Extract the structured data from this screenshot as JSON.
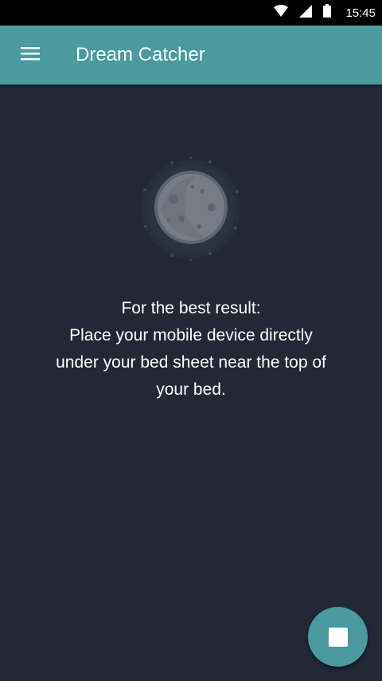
{
  "status_bar": {
    "time": "15:45",
    "icons": [
      "wifi-icon",
      "signal-icon",
      "battery-icon"
    ]
  },
  "app_bar": {
    "menu_icon": "hamburger-menu-icon",
    "title": "Dream Catcher"
  },
  "main": {
    "illustration_icon": "moon-icon",
    "instruction_lines": [
      "For the best result:",
      "Place your mobile device directly",
      "under your bed sheet near the top of",
      "your bed."
    ]
  },
  "fab": {
    "icon": "stop-icon"
  },
  "colors": {
    "background": "#232836",
    "accent": "#4a9aa0",
    "status_bar": "#000000",
    "text": "#ffffff"
  }
}
